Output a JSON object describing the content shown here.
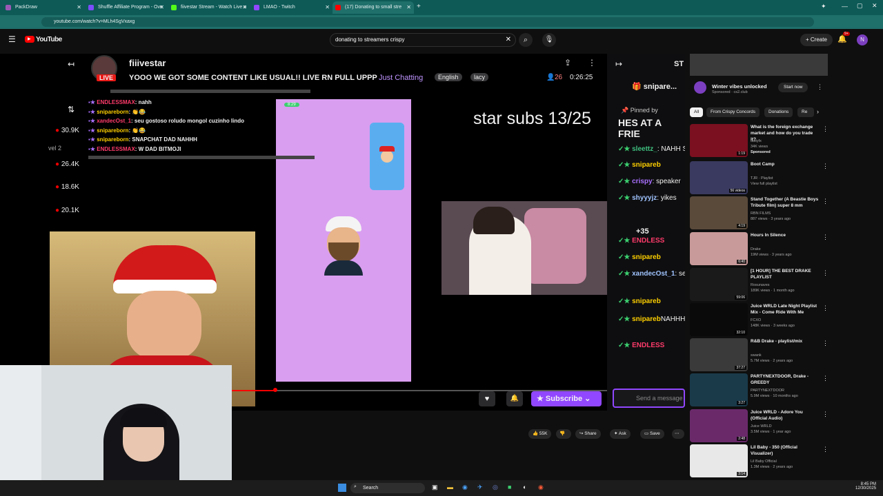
{
  "browser": {
    "tabs": [
      {
        "label": "PackDraw",
        "color": "#9b59b6"
      },
      {
        "label": "Shuffle Affiliate Program - Ove",
        "color": "#7b4dff"
      },
      {
        "label": "fiivestar Stream - Watch Live o",
        "color": "#53fc18"
      },
      {
        "label": "LMAO - Twitch",
        "color": "#9146ff"
      },
      {
        "label": "(17) Donating to small stre",
        "color": "#ff0000"
      }
    ],
    "url": "youtube.com/watch?v=MLh4SgVxaxg"
  },
  "youtube": {
    "logo": "YouTube",
    "search_value": "donating to streamers crispy",
    "create_label": "Create",
    "notif_count": "9+",
    "avatar": "N"
  },
  "stream": {
    "channel": "fiiivestar",
    "live": "LIVE",
    "title": "YOOO WE GOT SOME CONTENT LIKE USUAL!! LIVE RN PULL UPPP",
    "category": "Just Chatting",
    "tags": [
      "English",
      "lacy"
    ],
    "viewers": "26",
    "time": "0:26:25",
    "left_stats": [
      "30.9K",
      "26.4K",
      "18.6K",
      "20.1K"
    ],
    "left_level": "vel 2",
    "overlay_text": "star subs 13/25",
    "chat_lines": [
      {
        "user": "ENDLESSMAX",
        "text": ": nahh",
        "color": "#ff3b6b"
      },
      {
        "user": "snipareborn",
        "text": ": 👏😂",
        "color": "#ffd000"
      },
      {
        "user": "xandecOst_1",
        "text": ": seu gostoso roludo mongol cuzinho lindo",
        "color": "#ff3b6b"
      },
      {
        "user": "snipareborn",
        "text": ": 👏😂",
        "color": "#ffd000"
      },
      {
        "user": "snipareborn",
        "text": ": SNAPCHAT DAD NAHHH",
        "color": "#ffd000"
      },
      {
        "user": "ENDLESSMAX",
        "text": ": W DAD BITMOJI",
        "color": "#ff3b6b"
      }
    ],
    "phone_time": "8:29",
    "subscribe": "Subscribe"
  },
  "right_chat": {
    "header": "ST",
    "pinned_user": "snipare...",
    "pinned_label": "Pinned by",
    "pinned_msg": "HES AT A FRIE",
    "more": "+35",
    "lines": [
      {
        "user": "sleettz_",
        "text": ": NAHH SNA",
        "color": "#3fbf7f"
      },
      {
        "user": "snipareb",
        "text": "",
        "color": "#ffd000"
      },
      {
        "user": "crispy",
        "text": ": speaker",
        "color": "#a970ff"
      },
      {
        "user": "shyyyjz",
        "text": ": yikes",
        "color": "#a0c4ff"
      },
      {
        "user": "ENDLESS",
        "text": "",
        "color": "#ff3b6b"
      },
      {
        "user": "snipareb",
        "text": "",
        "color": "#ffd000"
      },
      {
        "user": "xandecOst_1",
        "text": ": seu g cuzinho lindo",
        "color": "#a0c4ff"
      },
      {
        "user": "snipareb",
        "text": "",
        "color": "#ffd000"
      },
      {
        "user": "snipareb",
        "text": "NAHHH",
        "color": "#ffd000"
      },
      {
        "user": "ENDLESS",
        "text": "",
        "color": "#ff3b6b"
      }
    ],
    "send_placeholder": "Send a message"
  },
  "actions": {
    "likes": "55K",
    "share": "Share",
    "ask": "Ask",
    "save": "Save"
  },
  "ad": {
    "title": "Winter vibes unlocked",
    "sponsor": "Sponsored · cs2.club",
    "cta": "Start now"
  },
  "chips": [
    "All",
    "From Crispy Concords",
    "Donations",
    "Re"
  ],
  "recs": [
    {
      "title": "What is the foreign exchange market and how do you trade it?",
      "meta1": "tastyfx",
      "meta2": "34K views",
      "meta3": "Sponsored",
      "dur": "1:19",
      "color": "#7a1020"
    },
    {
      "title": "Boot Camp",
      "meta1": "TJR · Playlist",
      "meta2": "View full playlist",
      "meta3": "",
      "dur": "56 videos",
      "color": "#3a3a60"
    },
    {
      "title": "Stand Together (A Beastie Boys Tribute film) super 8 mm",
      "meta1": "RBN FILMS",
      "meta2": "887 views · 3 years ago",
      "meta3": "",
      "dur": "4:19",
      "color": "#5a4a3a"
    },
    {
      "title": "Hours In Silence",
      "meta1": "Drake",
      "meta2": "19M views · 3 years ago",
      "meta3": "",
      "dur": "6:40",
      "color": "#c99a9a"
    },
    {
      "title": "[1 HOUR] THE BEST DRAKE PLAYLIST",
      "meta1": "Rosunaves",
      "meta2": "189K views · 1 month ago",
      "meta3": "",
      "dur": "59:06",
      "color": "#1a1a1a"
    },
    {
      "title": "Juice WRLD Late Night Playlist Mix - Come Ride With Me",
      "meta1": "FCXO",
      "meta2": "148K views · 3 weeks ago",
      "meta3": "",
      "dur": "32:10",
      "color": "#0a0a0a"
    },
    {
      "title": "R&B Drake - playlist/mix",
      "meta1": "swank",
      "meta2": "5.7M views · 2 years ago",
      "meta3": "",
      "dur": "37:27",
      "color": "#3a3a3a"
    },
    {
      "title": "PARTYNEXTDOOR, Drake - GREEDY",
      "meta1": "PARTYNEXTDOOR",
      "meta2": "5.9M views · 10 months ago",
      "meta3": "",
      "dur": "3:27",
      "color": "#1a3a4a"
    },
    {
      "title": "Juice WRLD - Adore You (Official Audio)",
      "meta1": "Juice WRLD",
      "meta2": "3.5M views · 1 year ago",
      "meta3": "",
      "dur": "2:48",
      "color": "#6a2a6a"
    },
    {
      "title": "Lil Baby - 350 (Official Visualizer)",
      "meta1": "Lil Baby Official",
      "meta2": "1.3M views · 2 years ago",
      "meta3": "",
      "dur": "3:14",
      "color": "#e8e8e8"
    }
  ],
  "taskbar": {
    "search": "Search",
    "time": "8:45 PM",
    "date": "12/30/2025"
  }
}
